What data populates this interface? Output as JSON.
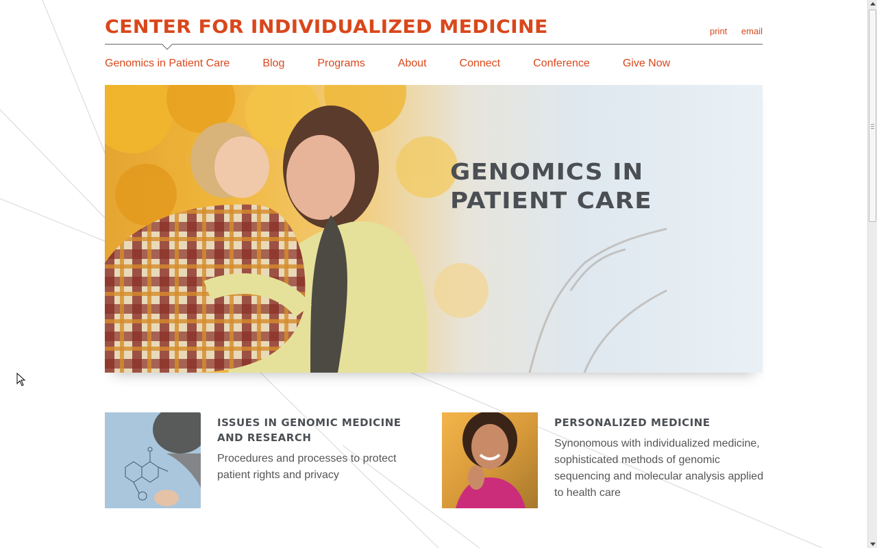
{
  "header": {
    "site_title": "CENTER FOR INDIVIDUALIZED MEDICINE",
    "utility_links": [
      "print",
      "email"
    ]
  },
  "nav": {
    "items": [
      "Genomics in Patient Care",
      "Blog",
      "Programs",
      "About",
      "Connect",
      "Conference",
      "Give Now"
    ]
  },
  "hero": {
    "title_line1": "GENOMICS IN",
    "title_line2": "PATIENT CARE",
    "image": "mother-hugging-child-autumn-photo"
  },
  "features": [
    {
      "title": "ISSUES IN GENOMIC MEDICINE AND RESEARCH",
      "description": "Procedures and processes to protect patient rights and privacy",
      "image": "molecule-drawing-photo"
    },
    {
      "title": "PERSONALIZED MEDICINE",
      "description": "Synonomous with individualized medicine, sophisticated methods of genomic sequencing and molecular analysis applied to health care",
      "image": "smiling-woman-photo"
    }
  ],
  "colors": {
    "accent": "#d9471b",
    "heading": "#4b4f54",
    "body_text": "#555555"
  }
}
